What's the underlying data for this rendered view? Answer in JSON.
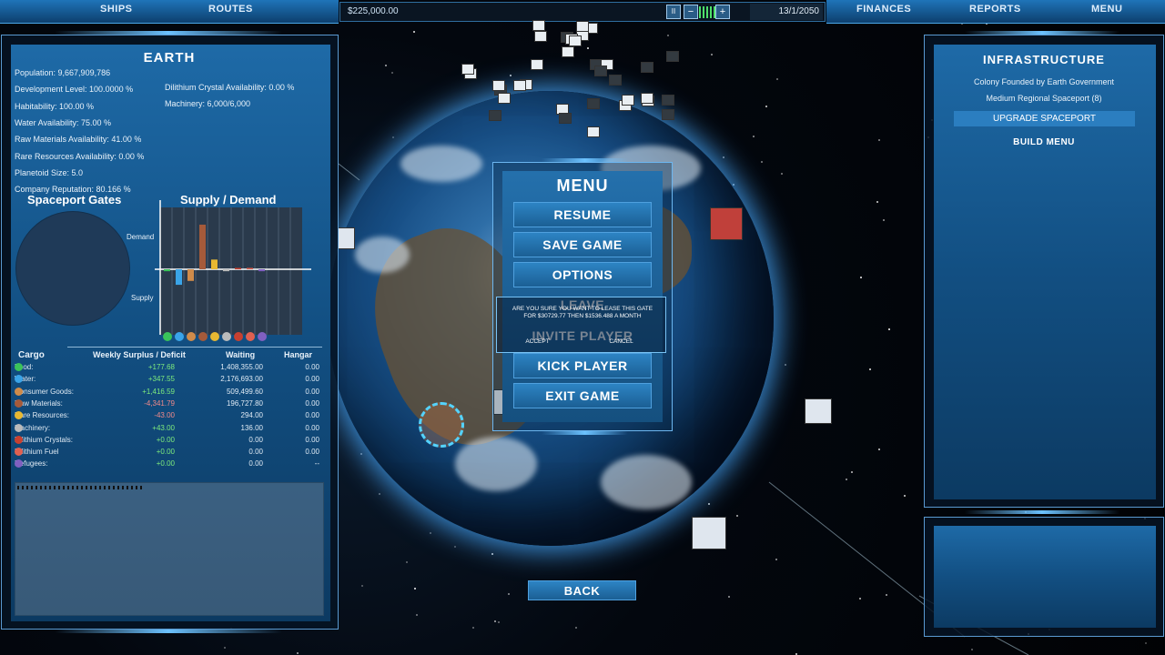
{
  "topbar": {
    "ships": "SHIPS",
    "routes": "ROUTES",
    "finances": "FINANCES",
    "reports": "REPORTS",
    "menu": "MENU"
  },
  "status": {
    "money": "$225,000.00",
    "date": "13/1/2050",
    "pause": "II",
    "minus": "−",
    "plus": "+"
  },
  "planet": {
    "name": "EARTH",
    "stats_left": [
      "Population: 9,667,909,786",
      "Development Level: 100.0000 %",
      "Habitability: 100.00 %",
      "Water Availability: 75.00 %",
      "Raw Materials Availability: 41.00 %",
      "Rare Resources Availability: 0.00 %",
      "Planetoid Size: 5.0",
      "Company Reputation: 80.166 %"
    ],
    "stats_right": [
      "Dilithium Crystal Availability: 0.00 %",
      "Machinery: 6,000/6,000"
    ],
    "gates_title": "Spaceport Gates",
    "supply_title": "Supply / Demand",
    "demand_label": "Demand",
    "supply_label": "Supply"
  },
  "chart_data": {
    "type": "bar",
    "title": "Supply / Demand",
    "categories": [
      "Food",
      "Water",
      "Consumer Goods",
      "Raw Materials",
      "Rare Resources",
      "Machinery",
      "Dilithium Crystals",
      "Dilithium Fuel",
      "Refugees"
    ],
    "values": [
      -0.1,
      -0.8,
      -0.6,
      2.3,
      0.5,
      -0.1,
      0,
      0,
      -0.1
    ],
    "ylim": [
      -3,
      3
    ],
    "colors": [
      "#3ac35a",
      "#3aa4e8",
      "#d08b4a",
      "#a55a3a",
      "#e8b832",
      "#bbbbbb",
      "#c84030",
      "#e06050",
      "#8060c0"
    ]
  },
  "cargo": {
    "headers": [
      "Cargo",
      "Weekly Surplus / Deficit",
      "Waiting",
      "Hangar"
    ],
    "rows": [
      {
        "name": "Food:",
        "surplus": "+177.68",
        "waiting": "1,408,355.00",
        "hangar": "0.00",
        "pos": true,
        "icon": "#3ac35a"
      },
      {
        "name": "Water:",
        "surplus": "+347.55",
        "waiting": "2,176,693.00",
        "hangar": "0.00",
        "pos": true,
        "icon": "#3aa4e8"
      },
      {
        "name": "Consumer Goods:",
        "surplus": "+1,416.59",
        "waiting": "509,499.60",
        "hangar": "0.00",
        "pos": true,
        "icon": "#d08b4a"
      },
      {
        "name": "Raw Materials:",
        "surplus": "-4,341.79",
        "waiting": "196,727.80",
        "hangar": "0.00",
        "pos": false,
        "icon": "#a55a3a"
      },
      {
        "name": "Rare Resources:",
        "surplus": "-43.00",
        "waiting": "294.00",
        "hangar": "0.00",
        "pos": false,
        "icon": "#e8b832"
      },
      {
        "name": "Machinery:",
        "surplus": "+43.00",
        "waiting": "136.00",
        "hangar": "0.00",
        "pos": true,
        "icon": "#bbbbbb"
      },
      {
        "name": "Dilithium Crystals:",
        "surplus": "+0.00",
        "waiting": "0.00",
        "hangar": "0.00",
        "pos": true,
        "icon": "#c84030"
      },
      {
        "name": "Dilithium Fuel",
        "surplus": "+0.00",
        "waiting": "0.00",
        "hangar": "0.00",
        "pos": true,
        "icon": "#e06050"
      },
      {
        "name": "Refugees:",
        "surplus": "+0.00",
        "waiting": "0.00",
        "hangar": "--",
        "pos": true,
        "icon": "#8060c0"
      }
    ]
  },
  "infrastructure": {
    "title": "INFRASTRUCTURE",
    "line1": "Colony Founded by Earth Government",
    "line2": "Medium Regional Spaceport (8)",
    "upgrade": "UPGRADE SPACEPORT",
    "build": "BUILD MENU"
  },
  "menu": {
    "title": "MENU",
    "items": [
      "RESUME",
      "SAVE GAME",
      "OPTIONS",
      "LEAVE",
      "INVITE PLAYER",
      "KICK PLAYER",
      "EXIT GAME"
    ],
    "back": "BACK"
  },
  "dialog": {
    "text": "ARE YOU SURE YOU WANT TO LEASE THIS GATE FOR $30729.77 THEN $1536.488 A MONTH",
    "accept": "ACCEPT",
    "cancel": "CANCEL"
  }
}
